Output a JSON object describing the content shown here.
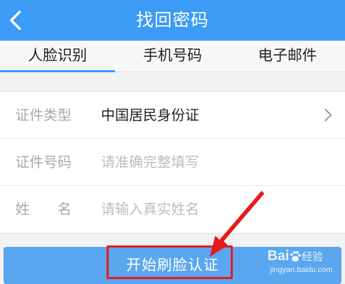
{
  "header": {
    "title": "找回密码",
    "back_icon": "chevron-left-icon"
  },
  "tabs": [
    {
      "label": "人脸识别",
      "active": true
    },
    {
      "label": "手机号码",
      "active": false
    },
    {
      "label": "电子邮件",
      "active": false
    }
  ],
  "form": {
    "id_type": {
      "label": "证件类型",
      "value": "中国居民身份证",
      "icon": "chevron-right-icon"
    },
    "id_number": {
      "label": "证件号码",
      "placeholder": "请准确完整填写"
    },
    "name": {
      "label": "姓　　名",
      "placeholder": "请输入真实姓名"
    }
  },
  "submit": {
    "label": "开始刷脸认证"
  },
  "watermark": {
    "brand": "Bai",
    "brand_suffix": "经验",
    "url": "jingyan.baidu.com"
  },
  "colors": {
    "accent": "#3b9bf5",
    "button": "#5aa7ef",
    "annotation": "#e8191c"
  }
}
